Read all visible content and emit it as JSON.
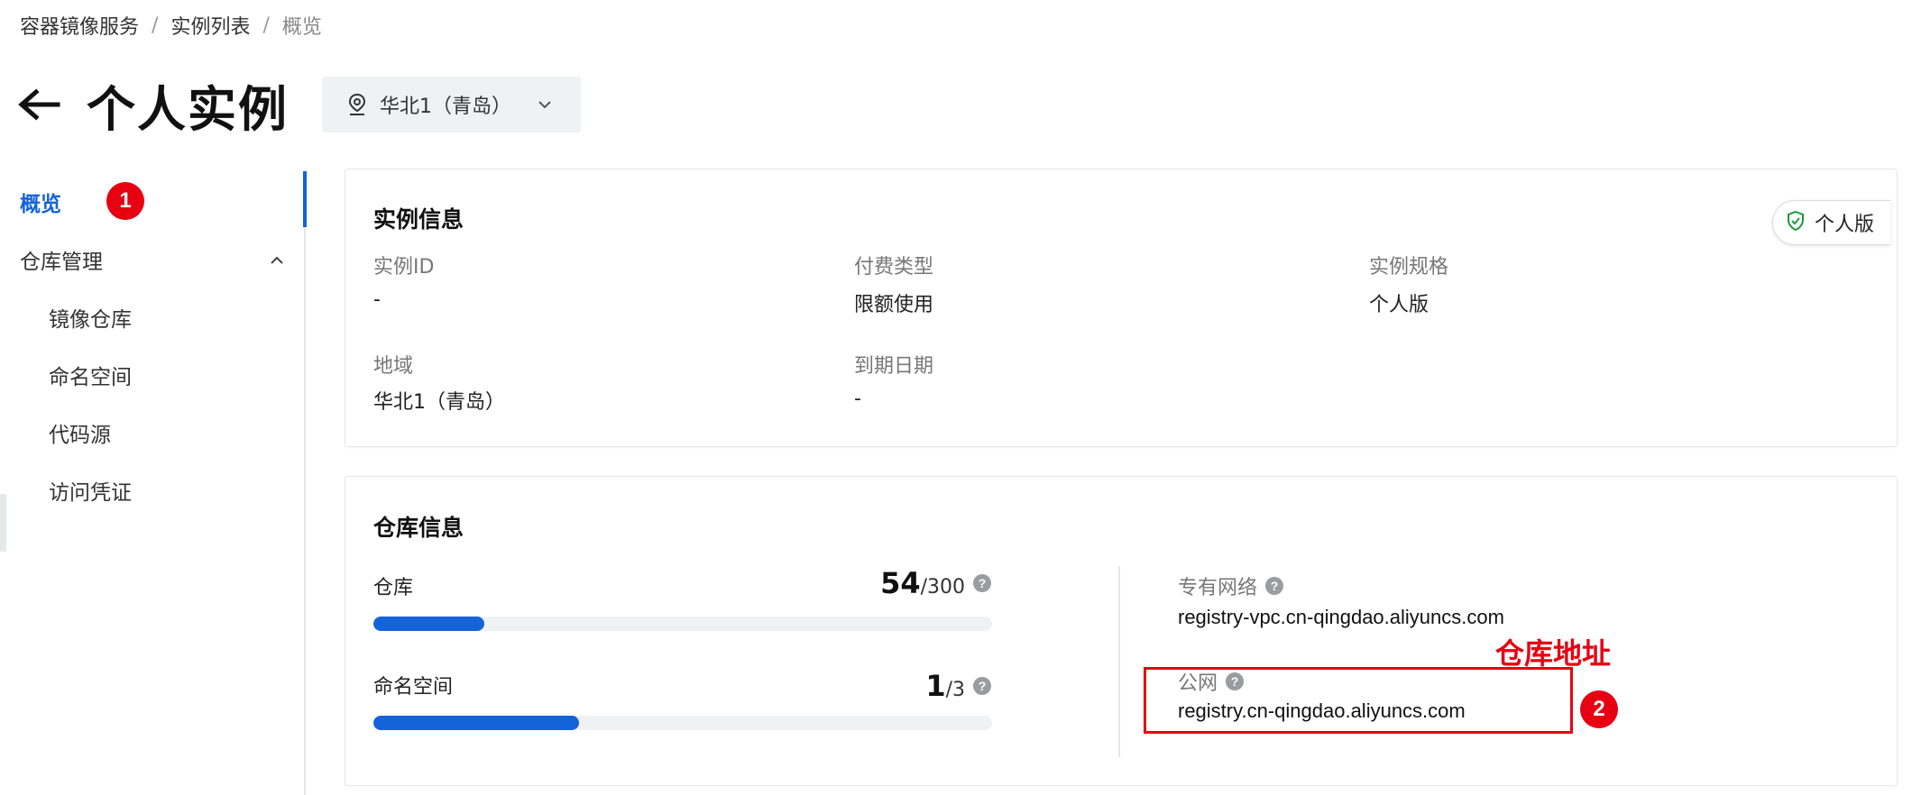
{
  "breadcrumb": {
    "items": [
      "容器镜像服务",
      "实例列表",
      "概览"
    ],
    "separator": "/"
  },
  "header": {
    "title": "个人实例",
    "region": "华北1（青岛）"
  },
  "sidebar": {
    "overview": "概览",
    "group_label": "仓库管理",
    "children": [
      "镜像仓库",
      "命名空间",
      "代码源",
      "访问凭证"
    ]
  },
  "annotations": {
    "badge1": "1",
    "badge2": "2",
    "callout": "仓库地址"
  },
  "instance_info": {
    "title": "实例信息",
    "edition_tag": "个人版",
    "fields": {
      "instance_id_label": "实例ID",
      "instance_id_value": "-",
      "billing_label": "付费类型",
      "billing_value": "限额使用",
      "spec_label": "实例规格",
      "spec_value": "个人版",
      "region_label": "地域",
      "region_value": "华北1（青岛）",
      "expiry_label": "到期日期",
      "expiry_value": "-"
    }
  },
  "repo_info": {
    "title": "仓库信息",
    "repos": {
      "label": "仓库",
      "used": "54",
      "total": "/300",
      "fraction": 0.18
    },
    "namespaces": {
      "label": "命名空间",
      "used": "1",
      "total": "/3",
      "fraction": 0.333
    },
    "vpc_label": "专有网络",
    "vpc_address": "registry-vpc.cn-qingdao.aliyuncs.com",
    "public_label": "公网",
    "public_address": "registry.cn-qingdao.aliyuncs.com"
  },
  "colors": {
    "accent": "#1463d9",
    "annotation": "#e60012",
    "tag_check": "#1a9c3e"
  },
  "icons": [
    "back-arrow-icon",
    "location-pin-icon",
    "chevron-down-icon",
    "chevron-up-icon",
    "shield-check-icon",
    "help-icon"
  ]
}
